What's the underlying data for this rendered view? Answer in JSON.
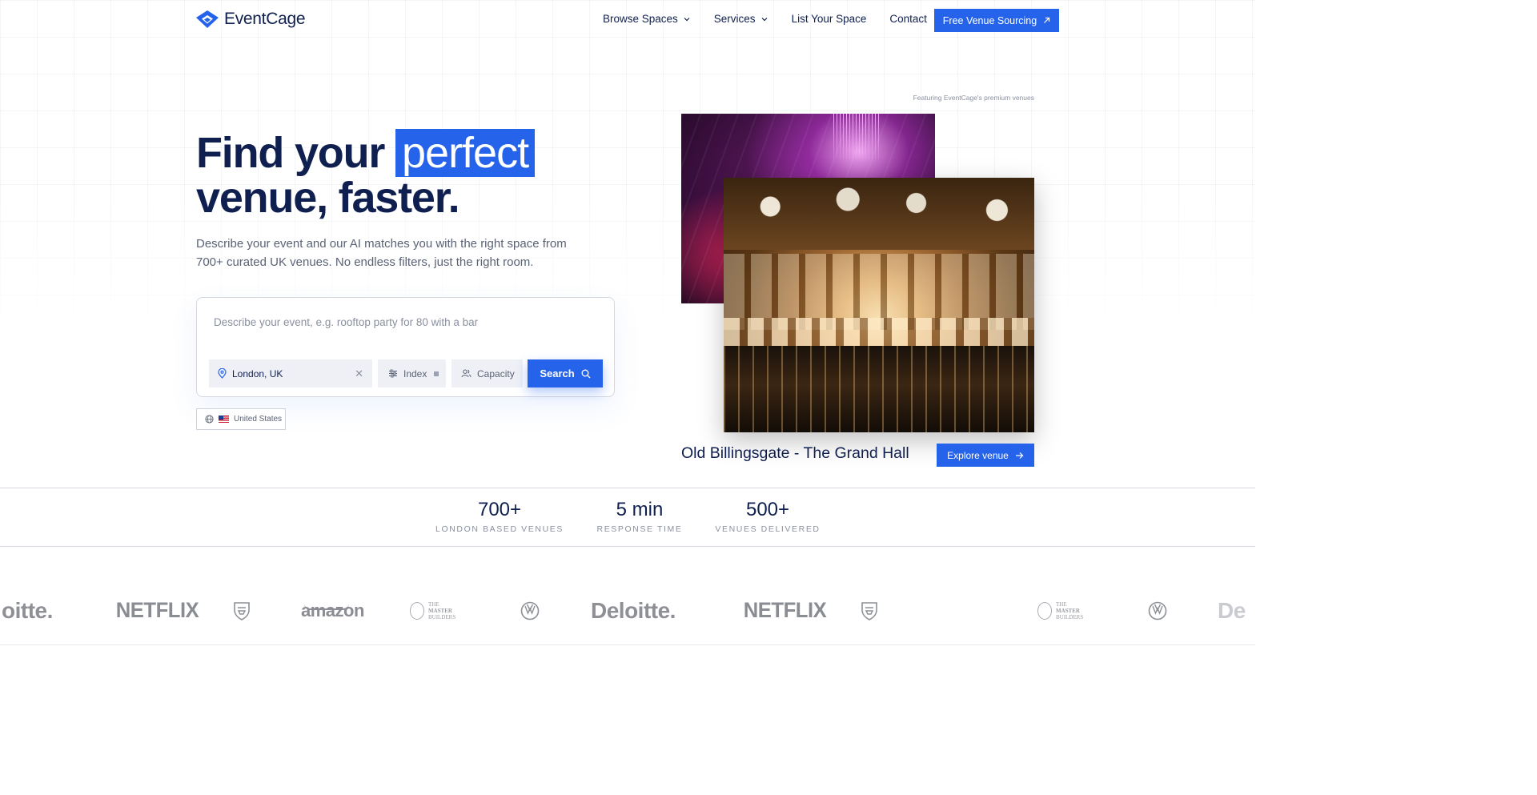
{
  "brand": {
    "name": "EventCage",
    "accent": "#2563eb",
    "ink": "#0f1f4f"
  },
  "nav": {
    "links": [
      {
        "label": "Browse Spaces",
        "has_dropdown": true
      },
      {
        "label": "Services",
        "has_dropdown": true
      },
      {
        "label": "List Your Space",
        "has_dropdown": false
      },
      {
        "label": "Contact",
        "has_dropdown": false
      }
    ],
    "cta": {
      "label": "Free Venue Sourcing",
      "icon": "arrow-up-right-icon"
    }
  },
  "hero": {
    "title_part1": "Find your",
    "title_highlight": "perfect",
    "title_line2": "venue, faster.",
    "subtitle": "Describe your event and our AI matches you with the right space from 700+ curated UK venues. No endless filters, just the right room."
  },
  "search": {
    "placeholder": "Describe your event, e.g. rooftop party for 80 with a bar",
    "value": "",
    "location": {
      "value": "London, UK",
      "icon": "map-pin-icon",
      "clear_icon": "close-icon"
    },
    "index": {
      "label": "Index",
      "icon": "sliders-icon"
    },
    "capacity": {
      "label": "Capacity",
      "icon": "users-icon"
    },
    "button": {
      "label": "Search",
      "icon": "search-icon"
    }
  },
  "region": {
    "label": "United States",
    "icon": "globe-icon",
    "flag": "us-flag"
  },
  "featured": {
    "caption": "Featuring EventCage's premium venues",
    "venue_name": "Old Billingsgate - The Grand Hall",
    "explore_label": "Explore venue",
    "explore_icon": "arrow-right-icon"
  },
  "stats": [
    {
      "value": "700+",
      "label": "LONDON BASED VENUES"
    },
    {
      "value": "5 min",
      "label": "RESPONSE TIME"
    },
    {
      "value": "500+",
      "label": "VENUES DELIVERED"
    }
  ],
  "client_logos": {
    "deloitte": "Deloitte.",
    "deloitte_partial": "oitte.",
    "deloitte_edge": "De",
    "netflix": "NETFLIX",
    "amazon": "amazon",
    "master_line1": "THE",
    "master_line2": "MASTER",
    "master_line3": "BUILDERS"
  }
}
